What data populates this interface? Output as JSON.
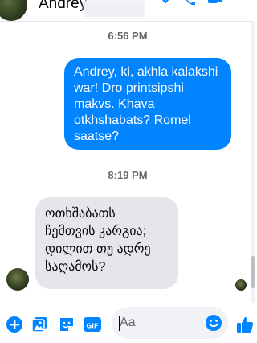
{
  "contact": {
    "name": "Andrey"
  },
  "messages": [
    {
      "type": "timestamp",
      "text": "6:56 PM"
    },
    {
      "type": "outgoing",
      "text": "Andrey, ki, akhla kalakshi war! Dro printsipshi makvs. Khava otkhshabats? Romel saatse?"
    },
    {
      "type": "timestamp",
      "text": "8:19 PM"
    },
    {
      "type": "incoming",
      "text": "ოთხშაბათს ჩემთვის კარგია; დილით თუ ადრე საღამოს?"
    }
  ],
  "composer": {
    "placeholder": "Aa"
  },
  "colors": {
    "accent": "#0084ff",
    "incoming_bubble": "#e4e6eb",
    "timestamp": "#65676b"
  },
  "icons": [
    "chevron-down-icon",
    "phone-icon",
    "video-icon",
    "plus-circle-icon",
    "photo-icon",
    "sticker-icon",
    "gif-icon",
    "emoji-icon",
    "thumbs-up-icon"
  ]
}
